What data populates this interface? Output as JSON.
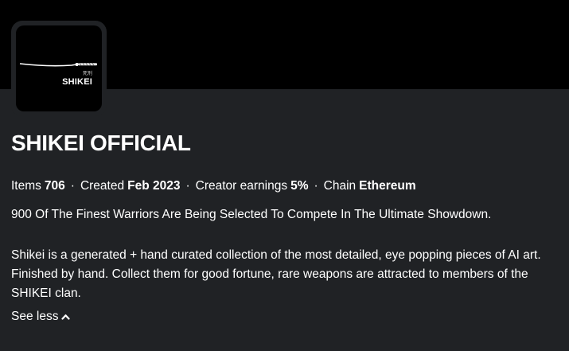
{
  "collection": {
    "avatar": {
      "kanji": "死刑",
      "name": "SHIKEI"
    },
    "title": "SHIKEI OFFICIAL",
    "stats": {
      "items_label": "Items",
      "items_value": "706",
      "created_label": "Created",
      "created_value": "Feb 2023",
      "earnings_label": "Creator earnings",
      "earnings_value": "5%",
      "chain_label": "Chain",
      "chain_value": "Ethereum",
      "separator": "·"
    },
    "tagline": "900 Of The Finest Warriors Are Being Selected To Compete In The Ultimate Showdown.",
    "description": "Shikei is a generated + hand curated collection of the most detailed, eye popping pieces of AI art. Finished by hand. Collect them for good fortune, rare weapons are attracted to members of the SHIKEI clan.",
    "see_less_label": "See less",
    "see_less_icon": "chevron-up-icon"
  },
  "colors": {
    "banner": "#000000",
    "background": "#202225",
    "text": "#ffffff"
  }
}
